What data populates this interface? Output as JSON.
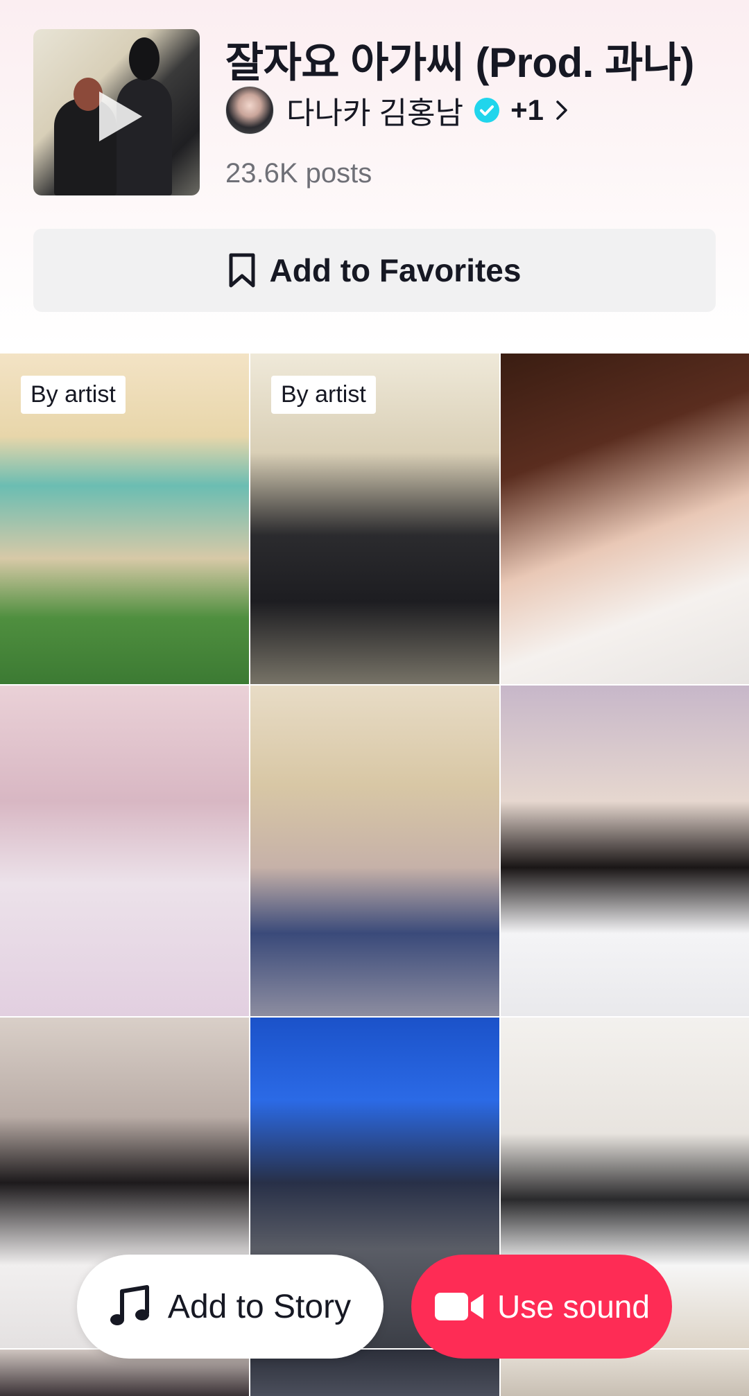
{
  "header": {
    "title": "잘자요 아가씨 (Prod. 과나)",
    "artist_name": "다나카 김홍남",
    "extra_artists": "+1",
    "posts_count": "23.6K posts"
  },
  "actions": {
    "favorites_label": "Add to Favorites",
    "story_label": "Add to Story",
    "use_sound_label": "Use sound"
  },
  "grid": {
    "tiles": [
      {
        "badge": "By artist"
      },
      {
        "badge": "By artist"
      },
      {
        "badge": ""
      },
      {
        "badge": ""
      },
      {
        "badge": ""
      },
      {
        "badge": ""
      },
      {
        "badge": ""
      },
      {
        "badge": ""
      },
      {
        "badge": ""
      }
    ]
  },
  "colors": {
    "accent": "#fe2c55",
    "verified": "#20d5ec",
    "text": "#161823",
    "muted": "#6f7077"
  },
  "icons": {
    "play": "play-icon",
    "verified": "verified-check-icon",
    "chevron": "chevron-right-icon",
    "bookmark": "bookmark-icon",
    "music": "music-note-icon",
    "camera": "video-camera-icon"
  }
}
